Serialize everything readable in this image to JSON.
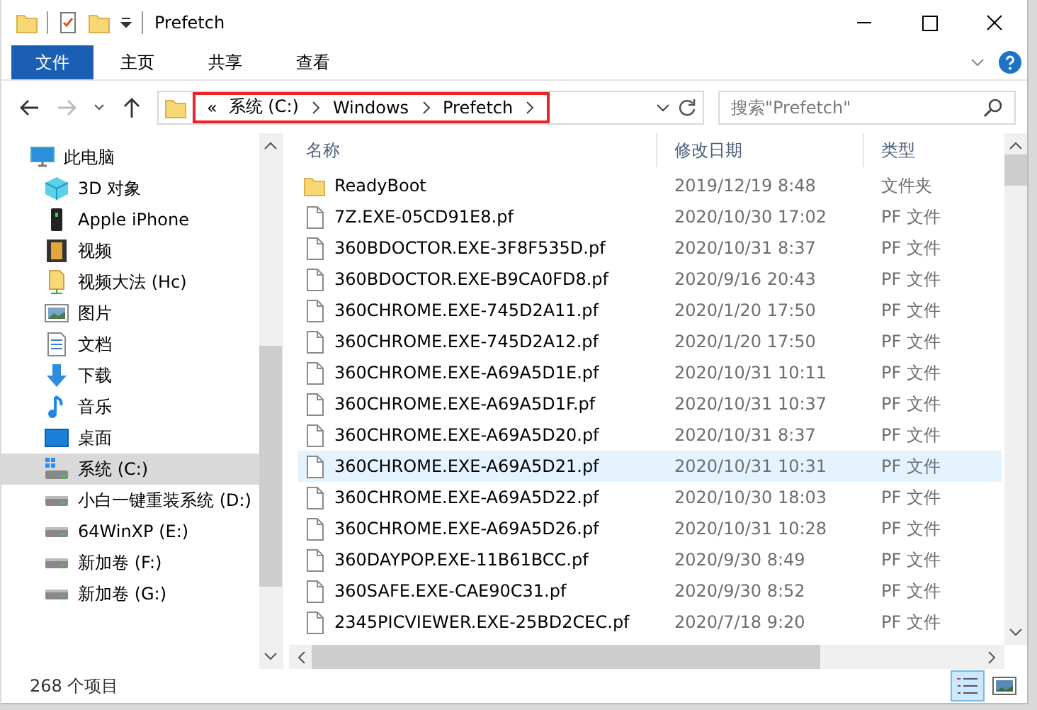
{
  "window": {
    "title": "Prefetch"
  },
  "ribbon_tabs": [
    {
      "label": "文件",
      "selected": true
    },
    {
      "label": "主页",
      "selected": false
    },
    {
      "label": "共享",
      "selected": false
    },
    {
      "label": "查看",
      "selected": false
    }
  ],
  "address": {
    "overflow": "«",
    "crumbs": [
      "系统 (C:)",
      "Windows",
      "Prefetch"
    ],
    "highlighted": true
  },
  "search": {
    "placeholder": "搜索\"Prefetch\""
  },
  "sidebar": {
    "items": [
      {
        "label": "此电脑",
        "kind": "pc",
        "selected": false,
        "children": [
          {
            "label": "3D 对象",
            "kind": "cube",
            "selected": false
          },
          {
            "label": "Apple iPhone",
            "kind": "phone",
            "selected": false
          },
          {
            "label": "视频",
            "kind": "film",
            "selected": false
          },
          {
            "label": "视频大法 (Hc)",
            "kind": "share",
            "selected": false
          },
          {
            "label": "图片",
            "kind": "picture",
            "selected": false
          },
          {
            "label": "文档",
            "kind": "document",
            "selected": false
          },
          {
            "label": "下载",
            "kind": "download",
            "selected": false
          },
          {
            "label": "音乐",
            "kind": "music",
            "selected": false
          },
          {
            "label": "桌面",
            "kind": "desktop",
            "selected": false
          },
          {
            "label": "系统 (C:)",
            "kind": "sysdrive",
            "selected": true
          },
          {
            "label": "小白一键重装系统 (D:)",
            "kind": "drive",
            "selected": false
          },
          {
            "label": "64WinXP  (E:)",
            "kind": "drive",
            "selected": false
          },
          {
            "label": "新加卷 (F:)",
            "kind": "drive",
            "selected": false
          },
          {
            "label": "新加卷 (G:)",
            "kind": "drive",
            "selected": false
          }
        ]
      }
    ]
  },
  "table": {
    "columns": [
      "名称",
      "修改日期",
      "类型"
    ],
    "rows": [
      {
        "name": "ReadyBoot",
        "date": "2019/12/19 8:48",
        "type": "文件夹",
        "kind": "folder",
        "selected": false
      },
      {
        "name": "7Z.EXE-05CD91E8.pf",
        "date": "2020/10/30 17:02",
        "type": "PF 文件",
        "kind": "file",
        "selected": false
      },
      {
        "name": "360BDOCTOR.EXE-3F8F535D.pf",
        "date": "2020/10/31 8:37",
        "type": "PF 文件",
        "kind": "file",
        "selected": false
      },
      {
        "name": "360BDOCTOR.EXE-B9CA0FD8.pf",
        "date": "2020/9/16 20:43",
        "type": "PF 文件",
        "kind": "file",
        "selected": false
      },
      {
        "name": "360CHROME.EXE-745D2A11.pf",
        "date": "2020/1/20 17:50",
        "type": "PF 文件",
        "kind": "file",
        "selected": false
      },
      {
        "name": "360CHROME.EXE-745D2A12.pf",
        "date": "2020/1/20 17:50",
        "type": "PF 文件",
        "kind": "file",
        "selected": false
      },
      {
        "name": "360CHROME.EXE-A69A5D1E.pf",
        "date": "2020/10/31 10:11",
        "type": "PF 文件",
        "kind": "file",
        "selected": false
      },
      {
        "name": "360CHROME.EXE-A69A5D1F.pf",
        "date": "2020/10/31 10:37",
        "type": "PF 文件",
        "kind": "file",
        "selected": false
      },
      {
        "name": "360CHROME.EXE-A69A5D20.pf",
        "date": "2020/10/31 8:37",
        "type": "PF 文件",
        "kind": "file",
        "selected": false
      },
      {
        "name": "360CHROME.EXE-A69A5D21.pf",
        "date": "2020/10/31 10:31",
        "type": "PF 文件",
        "kind": "file",
        "selected": true
      },
      {
        "name": "360CHROME.EXE-A69A5D22.pf",
        "date": "2020/10/30 18:03",
        "type": "PF 文件",
        "kind": "file",
        "selected": false
      },
      {
        "name": "360CHROME.EXE-A69A5D26.pf",
        "date": "2020/10/31 10:28",
        "type": "PF 文件",
        "kind": "file",
        "selected": false
      },
      {
        "name": "360DAYPOP.EXE-11B61BCC.pf",
        "date": "2020/9/30 8:49",
        "type": "PF 文件",
        "kind": "file",
        "selected": false
      },
      {
        "name": "360SAFE.EXE-CAE90C31.pf",
        "date": "2020/9/30 8:52",
        "type": "PF 文件",
        "kind": "file",
        "selected": false
      },
      {
        "name": "2345PICVIEWER.EXE-25BD2CEC.pf",
        "date": "2020/7/18 9:20",
        "type": "PF 文件",
        "kind": "file",
        "selected": false
      }
    ]
  },
  "status_bar": {
    "count": "268 个项目"
  },
  "view_buttons": [
    {
      "kind": "details",
      "selected": true
    },
    {
      "kind": "thumbnails",
      "selected": false
    }
  ]
}
